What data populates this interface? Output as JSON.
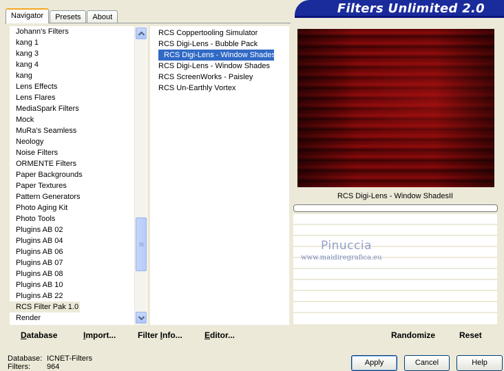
{
  "tabs": [
    "Navigator",
    "Presets",
    "About"
  ],
  "banner": {
    "title": "Filters Unlimited 2.0"
  },
  "categories": [
    "Johann's Filters",
    "kang 1",
    "kang 3",
    "kang 4",
    "kang",
    "Lens Effects",
    "Lens Flares",
    "MediaSpark Filters",
    "Mock",
    "MuRa's Seamless",
    "Neology",
    "Noise Filters",
    "ORMENTE Filters",
    "Paper Backgrounds",
    "Paper Textures",
    "Pattern Generators",
    "Photo Aging Kit",
    "Photo Tools",
    "Plugins AB 02",
    "Plugins AB 04",
    "Plugins AB 06",
    "Plugins AB 07",
    "Plugins AB 08",
    "Plugins AB 10",
    "Plugins AB 22",
    "RCS Filter Pak 1.0",
    "Render"
  ],
  "selected_category": "RCS Filter Pak 1.0",
  "filters": [
    "RCS Coppertooling Simulator",
    "RCS Digi-Lens - Bubble Pack",
    "RCS Digi-Lens - Window ShadesII",
    "RCS Digi-Lens - Window Shades",
    "RCS ScreenWorks - Paisley",
    "RCS Un-Earthly Vortex"
  ],
  "selected_filter": "RCS Digi-Lens - Window ShadesII",
  "preview": {
    "caption": "RCS Digi-Lens - Window ShadesII"
  },
  "watermark": {
    "name": "Pinuccia",
    "site": "www.maidiregrafica.eu"
  },
  "toolbar": {
    "database_first": "D",
    "database_rest": "atabase",
    "import_first": "I",
    "import_rest": "mport...",
    "filterinfo_a": "Filter ",
    "filterinfo_u": "I",
    "filterinfo_b": "nfo...",
    "editor_first": "E",
    "editor_rest": "ditor...",
    "randomize": "Randomize",
    "reset": "Reset"
  },
  "status": {
    "database_label": "Database:",
    "database_value": "ICNET-Filters",
    "filters_label": "Filters:",
    "filters_value": "964"
  },
  "buttons": {
    "apply": "Apply",
    "cancel": "Cancel",
    "help": "Help"
  },
  "colors": {
    "banner": "#1a2b9c",
    "selection": "#316ac5",
    "panel": "#ece9d8"
  },
  "icons": {
    "scroll_up": "chevron-up-icon",
    "scroll_down": "chevron-down-icon"
  }
}
